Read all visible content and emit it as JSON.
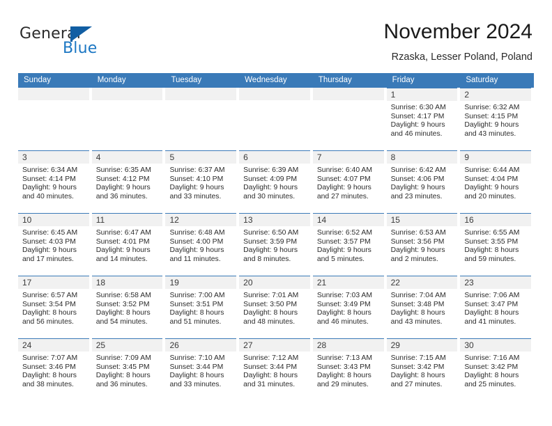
{
  "brand": {
    "name_part1": "General",
    "name_part2": "Blue",
    "logo_icon": "blue-flag-triangle-icon",
    "accent_color": "#1c77c3"
  },
  "header": {
    "title": "November 2024",
    "subtitle": "Rzaska, Lesser Poland, Poland"
  },
  "theme": {
    "header_blue": "#3a7ab8",
    "date_band_gray": "#f1f1f1",
    "text_color": "#2b2b2b"
  },
  "weekdays": [
    "Sunday",
    "Monday",
    "Tuesday",
    "Wednesday",
    "Thursday",
    "Friday",
    "Saturday"
  ],
  "weeks": [
    [
      {
        "date": "",
        "empty": true
      },
      {
        "date": "",
        "empty": true
      },
      {
        "date": "",
        "empty": true
      },
      {
        "date": "",
        "empty": true
      },
      {
        "date": "",
        "empty": true
      },
      {
        "date": "1",
        "sunrise": "Sunrise: 6:30 AM",
        "sunset": "Sunset: 4:17 PM",
        "daylight": "Daylight: 9 hours and 46 minutes."
      },
      {
        "date": "2",
        "sunrise": "Sunrise: 6:32 AM",
        "sunset": "Sunset: 4:15 PM",
        "daylight": "Daylight: 9 hours and 43 minutes."
      }
    ],
    [
      {
        "date": "3",
        "sunrise": "Sunrise: 6:34 AM",
        "sunset": "Sunset: 4:14 PM",
        "daylight": "Daylight: 9 hours and 40 minutes."
      },
      {
        "date": "4",
        "sunrise": "Sunrise: 6:35 AM",
        "sunset": "Sunset: 4:12 PM",
        "daylight": "Daylight: 9 hours and 36 minutes."
      },
      {
        "date": "5",
        "sunrise": "Sunrise: 6:37 AM",
        "sunset": "Sunset: 4:10 PM",
        "daylight": "Daylight: 9 hours and 33 minutes."
      },
      {
        "date": "6",
        "sunrise": "Sunrise: 6:39 AM",
        "sunset": "Sunset: 4:09 PM",
        "daylight": "Daylight: 9 hours and 30 minutes."
      },
      {
        "date": "7",
        "sunrise": "Sunrise: 6:40 AM",
        "sunset": "Sunset: 4:07 PM",
        "daylight": "Daylight: 9 hours and 27 minutes."
      },
      {
        "date": "8",
        "sunrise": "Sunrise: 6:42 AM",
        "sunset": "Sunset: 4:06 PM",
        "daylight": "Daylight: 9 hours and 23 minutes."
      },
      {
        "date": "9",
        "sunrise": "Sunrise: 6:44 AM",
        "sunset": "Sunset: 4:04 PM",
        "daylight": "Daylight: 9 hours and 20 minutes."
      }
    ],
    [
      {
        "date": "10",
        "sunrise": "Sunrise: 6:45 AM",
        "sunset": "Sunset: 4:03 PM",
        "daylight": "Daylight: 9 hours and 17 minutes."
      },
      {
        "date": "11",
        "sunrise": "Sunrise: 6:47 AM",
        "sunset": "Sunset: 4:01 PM",
        "daylight": "Daylight: 9 hours and 14 minutes."
      },
      {
        "date": "12",
        "sunrise": "Sunrise: 6:48 AM",
        "sunset": "Sunset: 4:00 PM",
        "daylight": "Daylight: 9 hours and 11 minutes."
      },
      {
        "date": "13",
        "sunrise": "Sunrise: 6:50 AM",
        "sunset": "Sunset: 3:59 PM",
        "daylight": "Daylight: 9 hours and 8 minutes."
      },
      {
        "date": "14",
        "sunrise": "Sunrise: 6:52 AM",
        "sunset": "Sunset: 3:57 PM",
        "daylight": "Daylight: 9 hours and 5 minutes."
      },
      {
        "date": "15",
        "sunrise": "Sunrise: 6:53 AM",
        "sunset": "Sunset: 3:56 PM",
        "daylight": "Daylight: 9 hours and 2 minutes."
      },
      {
        "date": "16",
        "sunrise": "Sunrise: 6:55 AM",
        "sunset": "Sunset: 3:55 PM",
        "daylight": "Daylight: 8 hours and 59 minutes."
      }
    ],
    [
      {
        "date": "17",
        "sunrise": "Sunrise: 6:57 AM",
        "sunset": "Sunset: 3:54 PM",
        "daylight": "Daylight: 8 hours and 56 minutes."
      },
      {
        "date": "18",
        "sunrise": "Sunrise: 6:58 AM",
        "sunset": "Sunset: 3:52 PM",
        "daylight": "Daylight: 8 hours and 54 minutes."
      },
      {
        "date": "19",
        "sunrise": "Sunrise: 7:00 AM",
        "sunset": "Sunset: 3:51 PM",
        "daylight": "Daylight: 8 hours and 51 minutes."
      },
      {
        "date": "20",
        "sunrise": "Sunrise: 7:01 AM",
        "sunset": "Sunset: 3:50 PM",
        "daylight": "Daylight: 8 hours and 48 minutes."
      },
      {
        "date": "21",
        "sunrise": "Sunrise: 7:03 AM",
        "sunset": "Sunset: 3:49 PM",
        "daylight": "Daylight: 8 hours and 46 minutes."
      },
      {
        "date": "22",
        "sunrise": "Sunrise: 7:04 AM",
        "sunset": "Sunset: 3:48 PM",
        "daylight": "Daylight: 8 hours and 43 minutes."
      },
      {
        "date": "23",
        "sunrise": "Sunrise: 7:06 AM",
        "sunset": "Sunset: 3:47 PM",
        "daylight": "Daylight: 8 hours and 41 minutes."
      }
    ],
    [
      {
        "date": "24",
        "sunrise": "Sunrise: 7:07 AM",
        "sunset": "Sunset: 3:46 PM",
        "daylight": "Daylight: 8 hours and 38 minutes."
      },
      {
        "date": "25",
        "sunrise": "Sunrise: 7:09 AM",
        "sunset": "Sunset: 3:45 PM",
        "daylight": "Daylight: 8 hours and 36 minutes."
      },
      {
        "date": "26",
        "sunrise": "Sunrise: 7:10 AM",
        "sunset": "Sunset: 3:44 PM",
        "daylight": "Daylight: 8 hours and 33 minutes."
      },
      {
        "date": "27",
        "sunrise": "Sunrise: 7:12 AM",
        "sunset": "Sunset: 3:44 PM",
        "daylight": "Daylight: 8 hours and 31 minutes."
      },
      {
        "date": "28",
        "sunrise": "Sunrise: 7:13 AM",
        "sunset": "Sunset: 3:43 PM",
        "daylight": "Daylight: 8 hours and 29 minutes."
      },
      {
        "date": "29",
        "sunrise": "Sunrise: 7:15 AM",
        "sunset": "Sunset: 3:42 PM",
        "daylight": "Daylight: 8 hours and 27 minutes."
      },
      {
        "date": "30",
        "sunrise": "Sunrise: 7:16 AM",
        "sunset": "Sunset: 3:42 PM",
        "daylight": "Daylight: 8 hours and 25 minutes."
      }
    ]
  ]
}
